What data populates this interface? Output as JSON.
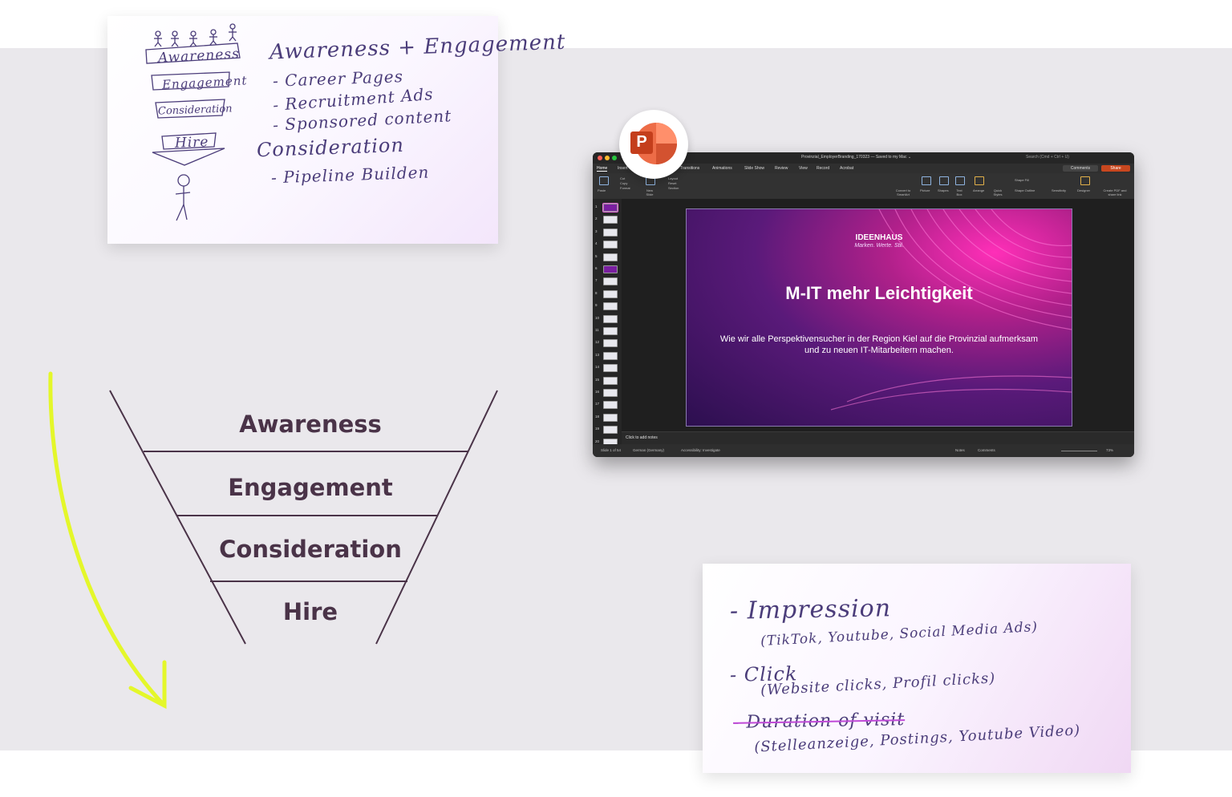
{
  "card_funnel_sketch": {
    "stages": [
      "Awareness",
      "Engagement",
      "Consideration",
      "Hire"
    ],
    "heading": "Awareness + Engagement",
    "bullets_1": [
      "- Career Pages",
      "- Recruitment Ads",
      "- Sponsored content"
    ],
    "heading_2": "Consideration",
    "bullets_2": [
      "- Pipeline Builden"
    ]
  },
  "funnel": {
    "stages": [
      "Awareness",
      "Engagement",
      "Consideration",
      "Hire"
    ],
    "line_color": "#4a3348",
    "arrow_color": "#e4f72a"
  },
  "card_metrics_sketch": {
    "items": [
      {
        "title": "- Impression",
        "detail": "(TikTok, Youtube, Social Media Ads)"
      },
      {
        "title": "- Click",
        "detail": "(Website clicks, Profil clicks)"
      },
      {
        "title": "- Duration of visit",
        "detail": "(Stelleanzeige, Postings, Youtube Video)"
      }
    ]
  },
  "powerpoint": {
    "app_icon": "powerpoint-icon",
    "badge_letter": "P",
    "window_title": "Provinzial_EmployerBranding_170323 — Saved to my Mac ⌄",
    "search_placeholder": "Search (Cmd + Ctrl + U)",
    "menu_tabs": [
      "Home",
      "Insert",
      "Draw",
      "Design",
      "Transitions",
      "Animations",
      "Slide Show",
      "Review",
      "View",
      "Record",
      "Acrobat"
    ],
    "active_tab": "Home",
    "comments_label": "Comments",
    "share_label": "Share",
    "ribbon": {
      "paste": "Paste",
      "cut": "Cut",
      "copy": "Copy",
      "format": "Format",
      "new_slide": "New Slide",
      "layout": "Layout",
      "reset": "Reset",
      "section": "Section",
      "convert": "Convert to SmartArt",
      "picture": "Picture",
      "shapes": "Shapes",
      "text_box": "Text Box",
      "arrange": "Arrange",
      "quick_styles": "Quick Styles",
      "shape_fill": "Shape Fill",
      "shape_outline": "Shape Outline",
      "sensitivity": "Sensitivity",
      "designer": "Designer",
      "create_pdf": "Create PDF and share link"
    },
    "slide_numbers": [
      "1",
      "2",
      "3",
      "4",
      "5",
      "6",
      "7",
      "8",
      "9",
      "10",
      "11",
      "12",
      "13",
      "14",
      "15",
      "16",
      "17",
      "18",
      "19",
      "20"
    ],
    "slide": {
      "logo": "IDEENHAUS",
      "logo_sub": "Marken. Werte. Stil.",
      "title": "M-IT mehr Leichtigkeit",
      "subtitle": "Wie wir alle Perspektivensucher in der Region Kiel auf die Provinzial aufmerksam und zu neuen IT-Mitarbeitern machen."
    },
    "notes_placeholder": "Click to add notes",
    "status": {
      "slide_count": "Slide 1 of 54",
      "language": "German (Germany)",
      "accessibility": "Accessibility: Investigate",
      "notes": "Notes",
      "comments": "Comments",
      "zoom": "73%"
    },
    "colors": {
      "accent": "#c8471f",
      "brand_red": "#d24726"
    }
  }
}
